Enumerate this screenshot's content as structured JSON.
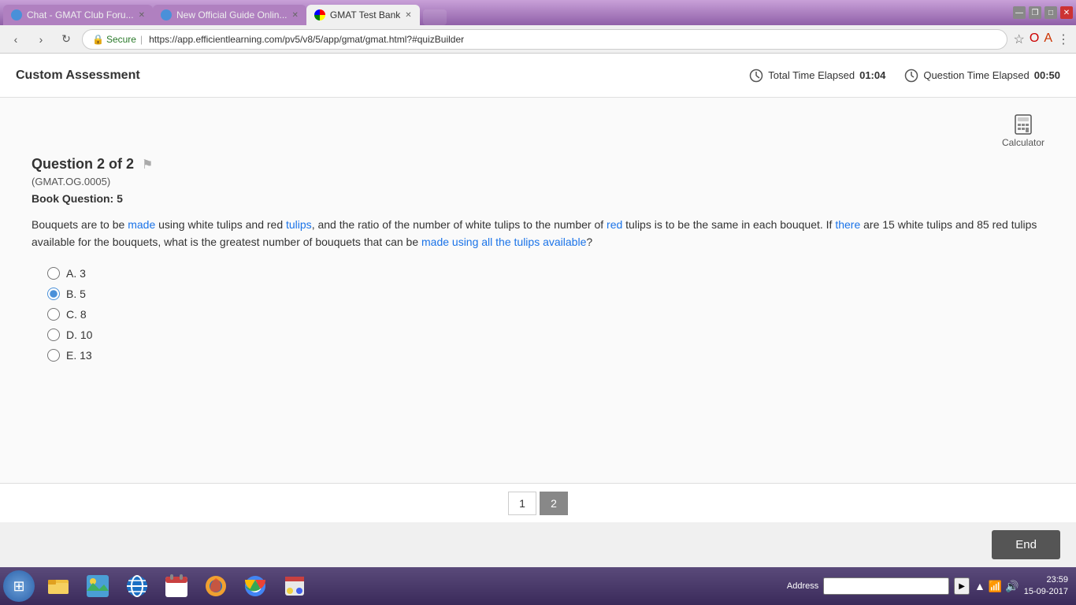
{
  "browser": {
    "tabs": [
      {
        "id": "tab1",
        "label": "Chat - GMAT Club Foru...",
        "active": false,
        "icon": "chat"
      },
      {
        "id": "tab2",
        "label": "New Official Guide Onlin...",
        "active": false,
        "icon": "guide"
      },
      {
        "id": "tab3",
        "label": "GMAT Test Bank",
        "active": true,
        "icon": "gmat"
      }
    ],
    "address": "https://app.efficientlearning.com/pv5/v8/5/app/gmat/gmat.html?#quizBuilder",
    "secure_label": "Secure"
  },
  "app": {
    "title": "Custom Assessment",
    "timers": {
      "total_label": "Total Time Elapsed",
      "total_value": "01:04",
      "question_label": "Question Time Elapsed",
      "question_value": "00:50"
    },
    "calculator_label": "Calculator"
  },
  "question": {
    "title": "Question 2 of 2",
    "id": "(GMAT.OG.0005)",
    "book_question": "Book Question: 5",
    "text_part1": "Bouquets are to be made using white tulips and red tulips, and the ratio of the number of white tulips to the number of red tulips is to be the same in each bouquet. If there are 15 white tulips and 85 red tulips available for the bouquets, what is the greatest number of bouquets that can be made using all the tulips available?",
    "choices": [
      {
        "id": "A",
        "label": "A. 3",
        "value": "3",
        "selected": false
      },
      {
        "id": "B",
        "label": "B. 5",
        "value": "5",
        "selected": true
      },
      {
        "id": "C",
        "label": "C. 8",
        "value": "8",
        "selected": false
      },
      {
        "id": "D",
        "label": "D. 10",
        "value": "10",
        "selected": false
      },
      {
        "id": "E",
        "label": "E. 13",
        "value": "13",
        "selected": false
      }
    ]
  },
  "navigation": {
    "pages": [
      {
        "num": "1",
        "active": false
      },
      {
        "num": "2",
        "active": true
      }
    ]
  },
  "footer": {
    "end_label": "End"
  },
  "taskbar": {
    "clock": "23:59",
    "date": "15-09-2017",
    "address_label": "Address"
  }
}
